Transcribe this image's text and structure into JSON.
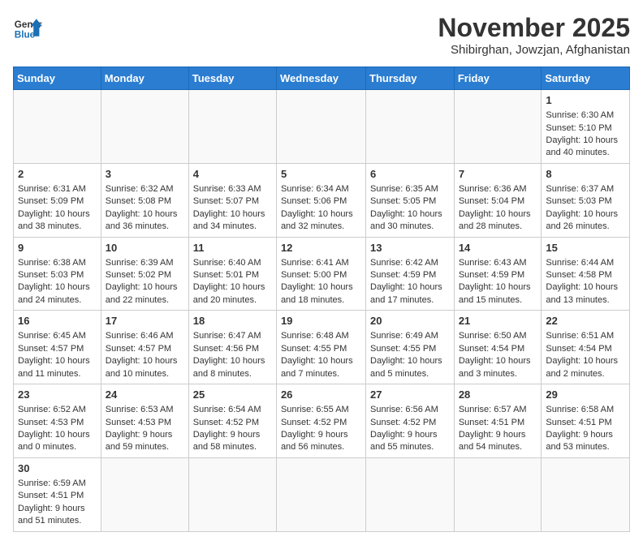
{
  "header": {
    "logo_general": "General",
    "logo_blue": "Blue",
    "month_title": "November 2025",
    "subtitle": "Shibirghan, Jowzjan, Afghanistan"
  },
  "weekdays": [
    "Sunday",
    "Monday",
    "Tuesday",
    "Wednesday",
    "Thursday",
    "Friday",
    "Saturday"
  ],
  "weeks": [
    [
      {
        "day": "",
        "info": ""
      },
      {
        "day": "",
        "info": ""
      },
      {
        "day": "",
        "info": ""
      },
      {
        "day": "",
        "info": ""
      },
      {
        "day": "",
        "info": ""
      },
      {
        "day": "",
        "info": ""
      },
      {
        "day": "1",
        "info": "Sunrise: 6:30 AM\nSunset: 5:10 PM\nDaylight: 10 hours and 40 minutes."
      }
    ],
    [
      {
        "day": "2",
        "info": "Sunrise: 6:31 AM\nSunset: 5:09 PM\nDaylight: 10 hours and 38 minutes."
      },
      {
        "day": "3",
        "info": "Sunrise: 6:32 AM\nSunset: 5:08 PM\nDaylight: 10 hours and 36 minutes."
      },
      {
        "day": "4",
        "info": "Sunrise: 6:33 AM\nSunset: 5:07 PM\nDaylight: 10 hours and 34 minutes."
      },
      {
        "day": "5",
        "info": "Sunrise: 6:34 AM\nSunset: 5:06 PM\nDaylight: 10 hours and 32 minutes."
      },
      {
        "day": "6",
        "info": "Sunrise: 6:35 AM\nSunset: 5:05 PM\nDaylight: 10 hours and 30 minutes."
      },
      {
        "day": "7",
        "info": "Sunrise: 6:36 AM\nSunset: 5:04 PM\nDaylight: 10 hours and 28 minutes."
      },
      {
        "day": "8",
        "info": "Sunrise: 6:37 AM\nSunset: 5:03 PM\nDaylight: 10 hours and 26 minutes."
      }
    ],
    [
      {
        "day": "9",
        "info": "Sunrise: 6:38 AM\nSunset: 5:03 PM\nDaylight: 10 hours and 24 minutes."
      },
      {
        "day": "10",
        "info": "Sunrise: 6:39 AM\nSunset: 5:02 PM\nDaylight: 10 hours and 22 minutes."
      },
      {
        "day": "11",
        "info": "Sunrise: 6:40 AM\nSunset: 5:01 PM\nDaylight: 10 hours and 20 minutes."
      },
      {
        "day": "12",
        "info": "Sunrise: 6:41 AM\nSunset: 5:00 PM\nDaylight: 10 hours and 18 minutes."
      },
      {
        "day": "13",
        "info": "Sunrise: 6:42 AM\nSunset: 4:59 PM\nDaylight: 10 hours and 17 minutes."
      },
      {
        "day": "14",
        "info": "Sunrise: 6:43 AM\nSunset: 4:59 PM\nDaylight: 10 hours and 15 minutes."
      },
      {
        "day": "15",
        "info": "Sunrise: 6:44 AM\nSunset: 4:58 PM\nDaylight: 10 hours and 13 minutes."
      }
    ],
    [
      {
        "day": "16",
        "info": "Sunrise: 6:45 AM\nSunset: 4:57 PM\nDaylight: 10 hours and 11 minutes."
      },
      {
        "day": "17",
        "info": "Sunrise: 6:46 AM\nSunset: 4:57 PM\nDaylight: 10 hours and 10 minutes."
      },
      {
        "day": "18",
        "info": "Sunrise: 6:47 AM\nSunset: 4:56 PM\nDaylight: 10 hours and 8 minutes."
      },
      {
        "day": "19",
        "info": "Sunrise: 6:48 AM\nSunset: 4:55 PM\nDaylight: 10 hours and 7 minutes."
      },
      {
        "day": "20",
        "info": "Sunrise: 6:49 AM\nSunset: 4:55 PM\nDaylight: 10 hours and 5 minutes."
      },
      {
        "day": "21",
        "info": "Sunrise: 6:50 AM\nSunset: 4:54 PM\nDaylight: 10 hours and 3 minutes."
      },
      {
        "day": "22",
        "info": "Sunrise: 6:51 AM\nSunset: 4:54 PM\nDaylight: 10 hours and 2 minutes."
      }
    ],
    [
      {
        "day": "23",
        "info": "Sunrise: 6:52 AM\nSunset: 4:53 PM\nDaylight: 10 hours and 0 minutes."
      },
      {
        "day": "24",
        "info": "Sunrise: 6:53 AM\nSunset: 4:53 PM\nDaylight: 9 hours and 59 minutes."
      },
      {
        "day": "25",
        "info": "Sunrise: 6:54 AM\nSunset: 4:52 PM\nDaylight: 9 hours and 58 minutes."
      },
      {
        "day": "26",
        "info": "Sunrise: 6:55 AM\nSunset: 4:52 PM\nDaylight: 9 hours and 56 minutes."
      },
      {
        "day": "27",
        "info": "Sunrise: 6:56 AM\nSunset: 4:52 PM\nDaylight: 9 hours and 55 minutes."
      },
      {
        "day": "28",
        "info": "Sunrise: 6:57 AM\nSunset: 4:51 PM\nDaylight: 9 hours and 54 minutes."
      },
      {
        "day": "29",
        "info": "Sunrise: 6:58 AM\nSunset: 4:51 PM\nDaylight: 9 hours and 53 minutes."
      }
    ],
    [
      {
        "day": "30",
        "info": "Sunrise: 6:59 AM\nSunset: 4:51 PM\nDaylight: 9 hours and 51 minutes."
      },
      {
        "day": "",
        "info": ""
      },
      {
        "day": "",
        "info": ""
      },
      {
        "day": "",
        "info": ""
      },
      {
        "day": "",
        "info": ""
      },
      {
        "day": "",
        "info": ""
      },
      {
        "day": "",
        "info": ""
      }
    ]
  ]
}
